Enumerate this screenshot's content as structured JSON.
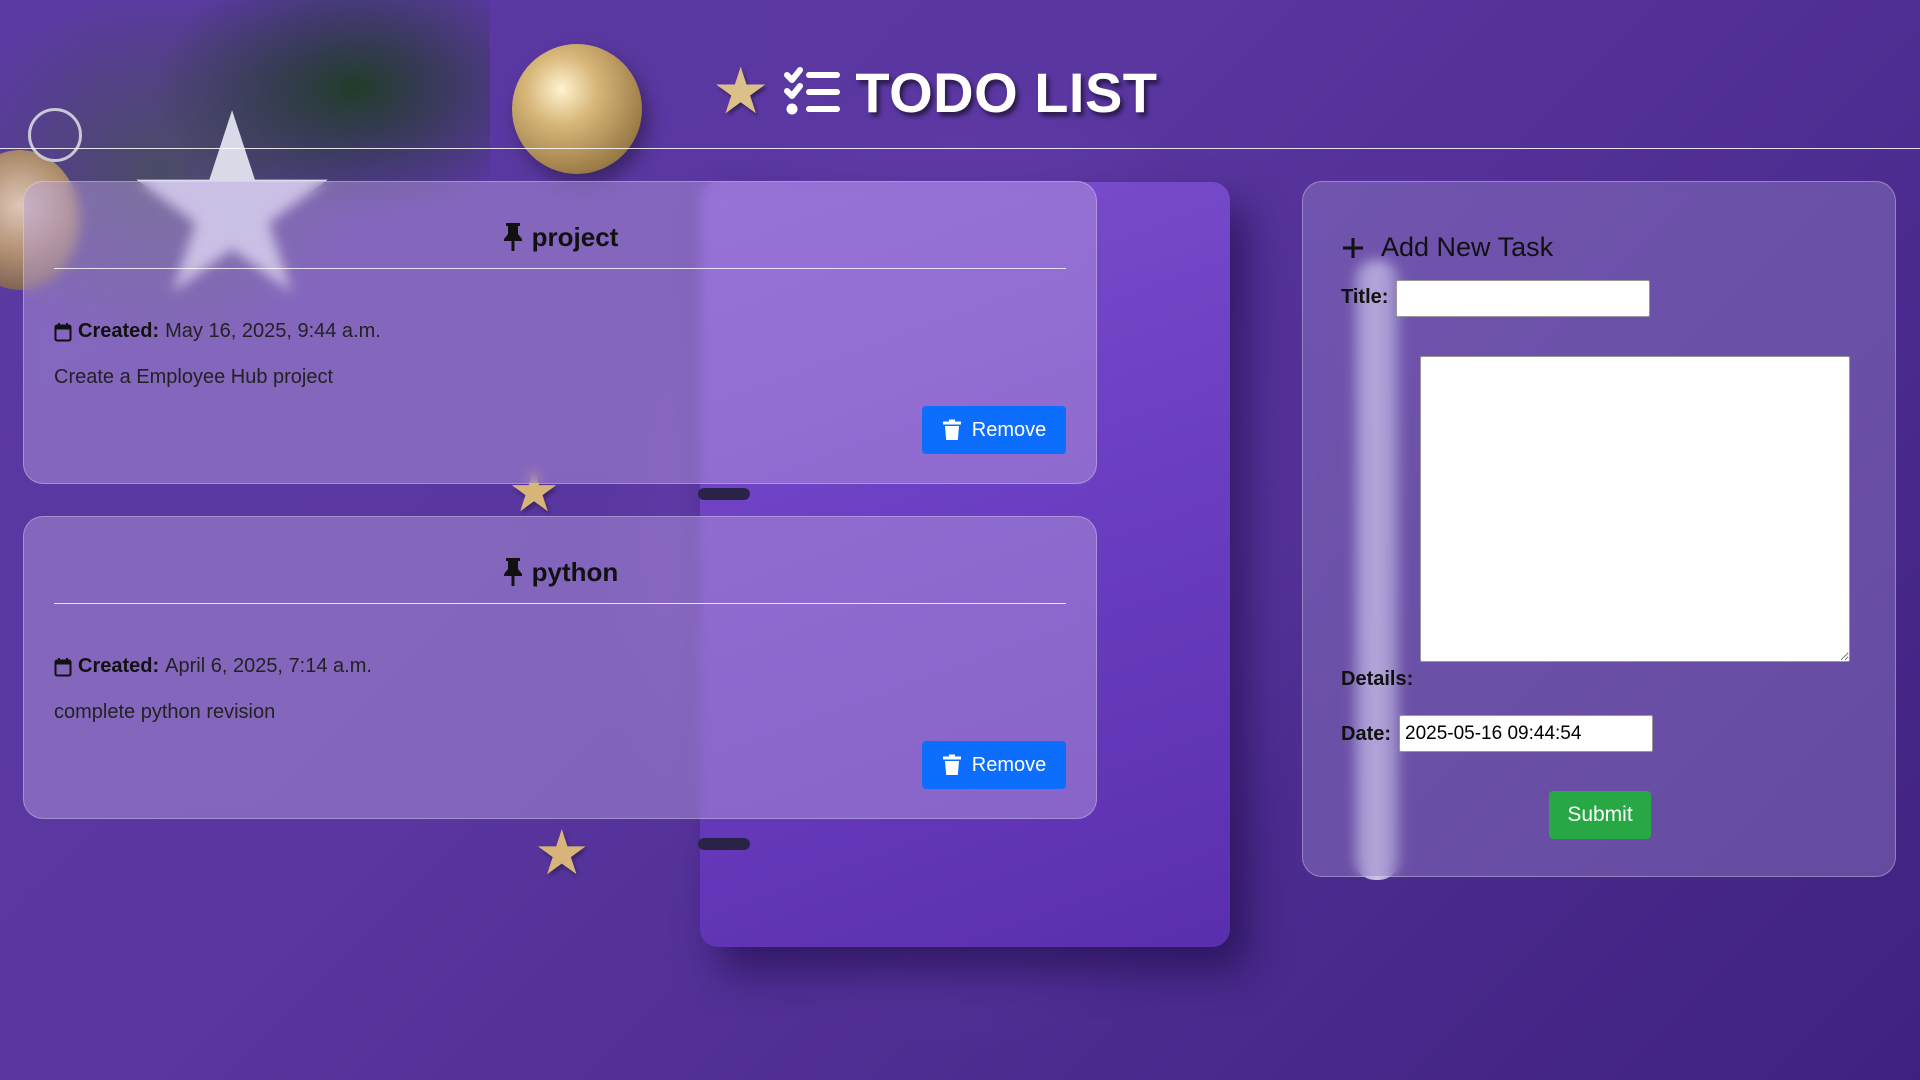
{
  "app": {
    "title": "TODO LIST",
    "icons": [
      "star-icon",
      "checklist-icon"
    ]
  },
  "tasks": [
    {
      "title": "project",
      "created_label": "Created:",
      "created_value": "May 16, 2025, 9:44 a.m.",
      "details": "Create a Employee Hub project",
      "remove_label": "Remove"
    },
    {
      "title": "python",
      "created_label": "Created:",
      "created_value": "April 6, 2025, 7:14 a.m.",
      "details": "complete python revision",
      "remove_label": "Remove"
    }
  ],
  "form": {
    "heading": "Add New Task",
    "title_label": "Title:",
    "title_value": "",
    "details_label": "Details:",
    "details_value": "",
    "date_label": "Date:",
    "date_value": "2025-05-16 09:44:54",
    "submit_label": "Submit"
  },
  "colors": {
    "remove_button": "#0d6efd",
    "submit_button": "#28a745",
    "background": "#5b3aa3"
  }
}
